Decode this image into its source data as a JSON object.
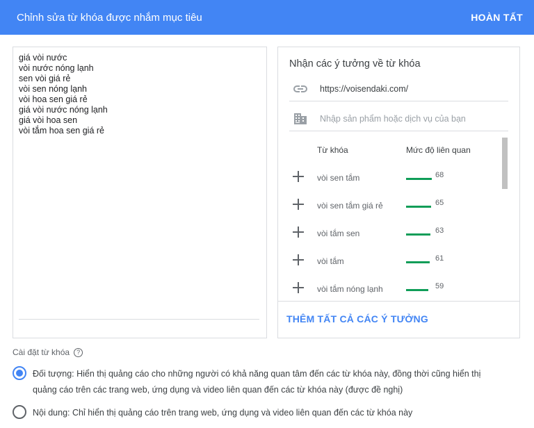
{
  "header": {
    "title": "Chỉnh sửa từ khóa được nhắm mục tiêu",
    "done_label": "HOÀN TẤT"
  },
  "keywords": {
    "items": [
      "giá vòi nước",
      "vòi nước nóng lạnh",
      "sen vòi giá rẻ",
      "vòi sen nóng lạnh",
      "vòi hoa sen giá rẻ",
      "giá vòi nước nóng lạnh",
      "giá vòi hoa sen",
      "vòi tắm hoa sen giá rẻ"
    ]
  },
  "ideas": {
    "title": "Nhận các ý tưởng về từ khóa",
    "url_value": "https://voisendaki.com/",
    "product_placeholder": "Nhập sản phẩm hoặc dịch vụ của bạn",
    "col_keyword": "Từ khóa",
    "col_relevance": "Mức độ liên quan",
    "rows": [
      {
        "keyword": "vòi sen tắm",
        "score": 68
      },
      {
        "keyword": "vòi sen tắm giá rẻ",
        "score": 65
      },
      {
        "keyword": "vòi tắm sen",
        "score": 63
      },
      {
        "keyword": "vòi tắm",
        "score": 61
      },
      {
        "keyword": "vòi tắm nóng lạnh",
        "score": 59
      }
    ],
    "add_all_label": "THÊM TẤT CẢ CÁC Ý TƯỞNG",
    "bar_color": "#0f9d58"
  },
  "settings": {
    "label": "Cài đặt từ khóa",
    "help_icon": "help-circle-icon",
    "options": [
      {
        "text": "Đối tượng: Hiển thị quảng cáo cho những người có khả năng quan tâm đến các từ khóa này, đồng thời cũng hiển thị quảng cáo trên các trang web, ứng dụng và video liên quan đến các từ khóa này (được đề nghị)",
        "checked": true
      },
      {
        "text": "Nội dung: Chỉ hiển thị quảng cáo trên trang web, ứng dụng và video liên quan đến các từ khóa này",
        "checked": false
      }
    ]
  },
  "colors": {
    "header_bg": "#4285f4",
    "accent": "#4285f4"
  }
}
